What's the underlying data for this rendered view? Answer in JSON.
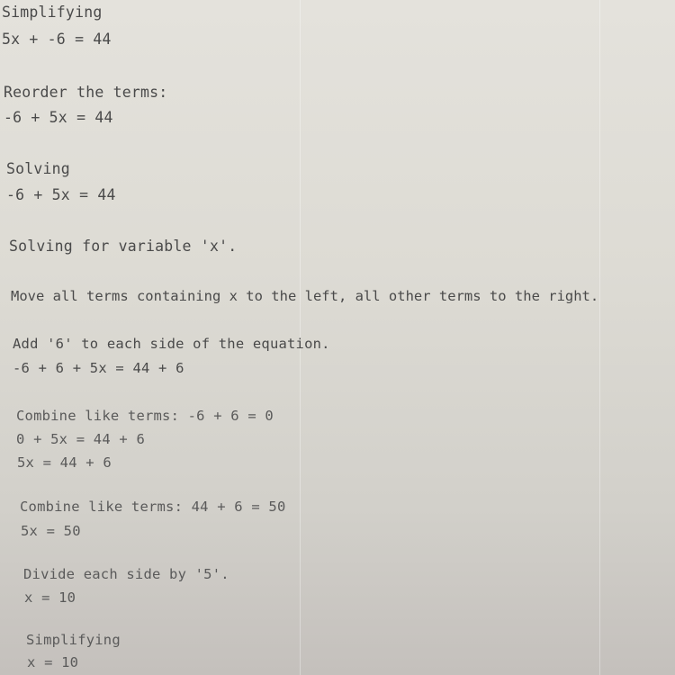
{
  "steps": [
    {
      "heading": "Simplifying",
      "lines": [
        "5x + -6 = 44"
      ]
    },
    {
      "heading": "Reorder the terms:",
      "lines": [
        "-6 + 5x = 44"
      ]
    },
    {
      "heading": "Solving",
      "lines": [
        "-6 + 5x = 44"
      ]
    },
    {
      "heading": "Solving for variable 'x'.",
      "lines": []
    },
    {
      "heading": "Move all terms containing x to the left, all other terms to the right.",
      "lines": []
    },
    {
      "heading": "Add '6' to each side of the equation.",
      "lines": [
        "-6 + 6 + 5x = 44 + 6"
      ]
    },
    {
      "heading": "Combine like terms: -6 + 6 = 0",
      "lines": [
        "0 + 5x = 44 + 6",
        "5x = 44 + 6"
      ]
    },
    {
      "heading": "Combine like terms: 44 + 6 = 50",
      "lines": [
        "5x = 50"
      ]
    },
    {
      "heading": "Divide each side by '5'.",
      "lines": [
        "x = 10"
      ]
    },
    {
      "heading": "Simplifying",
      "lines": [
        "x = 10"
      ]
    }
  ]
}
